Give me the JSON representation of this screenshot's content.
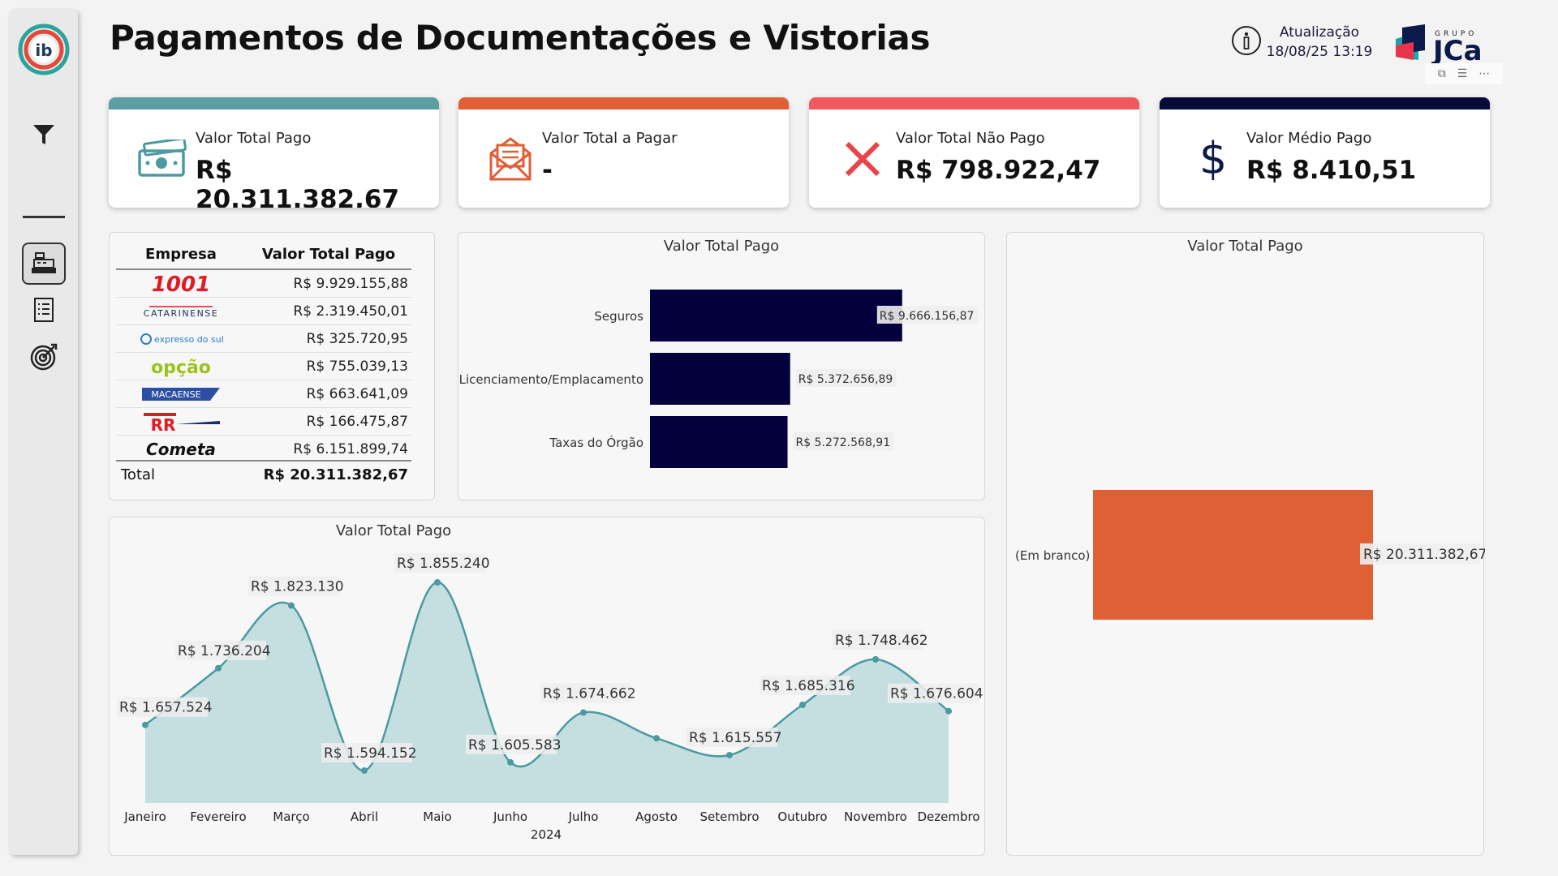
{
  "header": {
    "title": "Pagamentos de Documentações e Vistorias",
    "update_label": "Atualização",
    "update_value": "18/08/25 13:19",
    "logo_small": "GRUPO",
    "logo_big": "JCa"
  },
  "sidebar": {
    "items": [
      {
        "name": "filter",
        "icon": "filter-icon"
      },
      {
        "name": "payments",
        "icon": "cash-register-icon",
        "active": true
      },
      {
        "name": "list",
        "icon": "list-icon"
      },
      {
        "name": "target",
        "icon": "target-icon"
      }
    ]
  },
  "kpis": [
    {
      "label": "Valor Total Pago",
      "value": "R$ 20.311.382,67",
      "color": "#5b9fa3",
      "icon": "money-icon"
    },
    {
      "label": "Valor Total a Pagar",
      "value": "-",
      "color": "#e05f35",
      "icon": "envelope-icon"
    },
    {
      "label": "Valor Total Não Pago",
      "value": "R$ 798.922,47",
      "color": "#f05a5e",
      "icon": "x-icon"
    },
    {
      "label": "Valor Médio Pago",
      "value": "R$ 8.410,51",
      "color": "#070b3a",
      "icon": "dollar-icon"
    }
  ],
  "table": {
    "headers": [
      "Empresa",
      "Valor Total Pago"
    ],
    "rows": [
      {
        "company": "1001",
        "value": "R$ 9.929.155,88"
      },
      {
        "company": "CATARINENSE",
        "value": "R$ 2.319.450,01"
      },
      {
        "company": "expresso do sul",
        "value": "R$ 325.720,95"
      },
      {
        "company": "opção",
        "value": "R$ 755.039,13"
      },
      {
        "company": "MACAENSE",
        "value": "R$ 663.641,09"
      },
      {
        "company": "RR",
        "value": "R$ 166.475,87"
      },
      {
        "company": "Cometa",
        "value": "R$ 6.151.899,74"
      }
    ],
    "total_label": "Total",
    "total_value": "R$ 20.311.382,67"
  },
  "chart_data": [
    {
      "type": "bar",
      "orientation": "horizontal",
      "title": "Valor Total Pago",
      "categories": [
        "Seguros",
        "Licenciamento/Emplacamento",
        "Taxas do Órgão"
      ],
      "values": [
        9666156.87,
        5372656.89,
        5272568.91
      ],
      "labels": [
        "R$ 9.666.156,87",
        "R$ 5.372.656,89",
        "R$ 5.272.568,91"
      ],
      "color": "#04003e"
    },
    {
      "type": "bar",
      "orientation": "horizontal",
      "title": "Valor Total Pago",
      "categories": [
        "(Em branco)"
      ],
      "values": [
        20311382.67
      ],
      "labels": [
        "R$ 20.311.382,67"
      ],
      "color": "#e06035"
    },
    {
      "type": "area",
      "title": "Valor Total Pago",
      "xlabel": "2024",
      "categories": [
        "Janeiro",
        "Fevereiro",
        "Março",
        "Abril",
        "Maio",
        "Junho",
        "Julho",
        "Agosto",
        "Setembro",
        "Outubro",
        "Novembro",
        "Dezembro"
      ],
      "values": [
        1657524,
        1736204,
        1823130,
        1594152,
        1855240,
        1605583,
        1674662,
        1639000,
        1615557,
        1685316,
        1748462,
        1676604
      ],
      "labels": [
        "R$ 1.657.524",
        "R$ 1.736.204",
        "R$ 1.823.130",
        "R$ 1.594.152",
        "R$ 1.855.240",
        "R$ 1.605.583",
        "R$ 1.674.662",
        "",
        "R$ 1.615.557",
        "R$ 1.685.316",
        "R$ 1.748.462",
        "R$ 1.676.604"
      ],
      "line_color": "#4a9aa0",
      "fill_color": "#c5dfe1"
    }
  ]
}
